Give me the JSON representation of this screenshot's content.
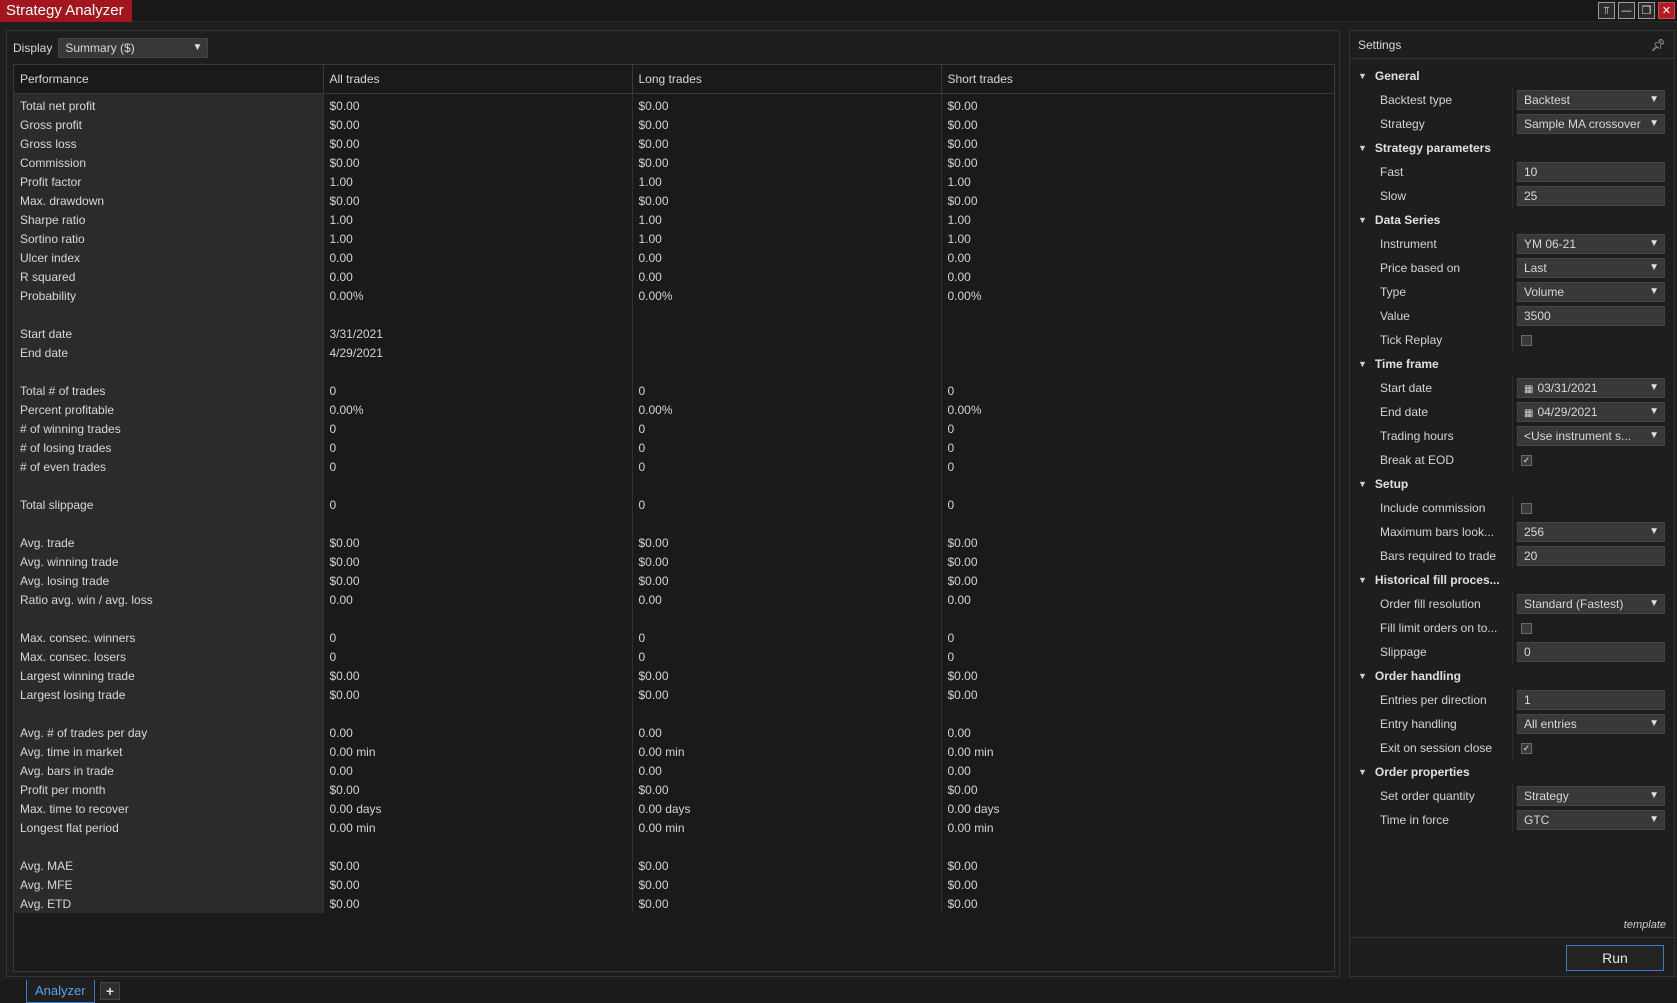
{
  "window": {
    "title": "Strategy Analyzer",
    "controls": [
      "⫪",
      "—",
      "❐",
      "✕"
    ]
  },
  "display": {
    "label": "Display",
    "value": "Summary ($)"
  },
  "table": {
    "headers": [
      "Performance",
      "All trades",
      "Long trades",
      "Short trades"
    ],
    "rows": [
      [
        "Total net profit",
        "$0.00",
        "$0.00",
        "$0.00"
      ],
      [
        "Gross profit",
        "$0.00",
        "$0.00",
        "$0.00"
      ],
      [
        "Gross loss",
        "$0.00",
        "$0.00",
        "$0.00"
      ],
      [
        "Commission",
        "$0.00",
        "$0.00",
        "$0.00"
      ],
      [
        "Profit factor",
        "1.00",
        "1.00",
        "1.00"
      ],
      [
        "Max. drawdown",
        "$0.00",
        "$0.00",
        "$0.00"
      ],
      [
        "Sharpe ratio",
        "1.00",
        "1.00",
        "1.00"
      ],
      [
        "Sortino ratio",
        "1.00",
        "1.00",
        "1.00"
      ],
      [
        "Ulcer index",
        "0.00",
        "0.00",
        "0.00"
      ],
      [
        "R squared",
        "0.00",
        "0.00",
        "0.00"
      ],
      [
        "Probability",
        "0.00%",
        "0.00%",
        "0.00%"
      ],
      [
        "",
        "",
        "",
        ""
      ],
      [
        "Start date",
        "3/31/2021",
        "",
        ""
      ],
      [
        "End date",
        "4/29/2021",
        "",
        ""
      ],
      [
        "",
        "",
        "",
        ""
      ],
      [
        "Total # of trades",
        "0",
        "0",
        "0"
      ],
      [
        "Percent profitable",
        "0.00%",
        "0.00%",
        "0.00%"
      ],
      [
        "# of winning trades",
        "0",
        "0",
        "0"
      ],
      [
        "# of losing trades",
        "0",
        "0",
        "0"
      ],
      [
        "# of even trades",
        "0",
        "0",
        "0"
      ],
      [
        "",
        "",
        "",
        ""
      ],
      [
        "Total slippage",
        "0",
        "0",
        "0"
      ],
      [
        "",
        "",
        "",
        ""
      ],
      [
        "Avg. trade",
        "$0.00",
        "$0.00",
        "$0.00"
      ],
      [
        "Avg. winning trade",
        "$0.00",
        "$0.00",
        "$0.00"
      ],
      [
        "Avg. losing trade",
        "$0.00",
        "$0.00",
        "$0.00"
      ],
      [
        "Ratio avg. win / avg. loss",
        "0.00",
        "0.00",
        "0.00"
      ],
      [
        "",
        "",
        "",
        ""
      ],
      [
        "Max. consec. winners",
        "0",
        "0",
        "0"
      ],
      [
        "Max. consec. losers",
        "0",
        "0",
        "0"
      ],
      [
        "Largest winning trade",
        "$0.00",
        "$0.00",
        "$0.00"
      ],
      [
        "Largest losing trade",
        "$0.00",
        "$0.00",
        "$0.00"
      ],
      [
        "",
        "",
        "",
        ""
      ],
      [
        "Avg. # of trades per day",
        "0.00",
        "0.00",
        "0.00"
      ],
      [
        "Avg. time in market",
        "0.00 min",
        "0.00 min",
        "0.00 min"
      ],
      [
        "Avg. bars in trade",
        "0.00",
        "0.00",
        "0.00"
      ],
      [
        "Profit per month",
        "$0.00",
        "$0.00",
        "$0.00"
      ],
      [
        "Max. time to recover",
        "0.00 days",
        "0.00 days",
        "0.00 days"
      ],
      [
        "Longest flat period",
        "0.00 min",
        "0.00 min",
        "0.00 min"
      ],
      [
        "",
        "",
        "",
        ""
      ],
      [
        "Avg. MAE",
        "$0.00",
        "$0.00",
        "$0.00"
      ],
      [
        "Avg. MFE",
        "$0.00",
        "$0.00",
        "$0.00"
      ],
      [
        "Avg. ETD",
        "$0.00",
        "$0.00",
        "$0.00"
      ]
    ]
  },
  "settings": {
    "title": "Settings",
    "template_label": "template",
    "run_label": "Run",
    "sections": [
      {
        "name": "General",
        "props": [
          {
            "name": "Backtest type",
            "kind": "dropdown",
            "value": "Backtest"
          },
          {
            "name": "Strategy",
            "kind": "dropdown",
            "value": "Sample MA crossover"
          }
        ]
      },
      {
        "name": "Strategy parameters",
        "props": [
          {
            "name": "Fast",
            "kind": "text",
            "value": "10"
          },
          {
            "name": "Slow",
            "kind": "text",
            "value": "25"
          }
        ]
      },
      {
        "name": "Data Series",
        "props": [
          {
            "name": "Instrument",
            "kind": "dropdown",
            "value": "YM 06-21"
          },
          {
            "name": "Price based on",
            "kind": "dropdown",
            "value": "Last"
          },
          {
            "name": "Type",
            "kind": "dropdown",
            "value": "Volume"
          },
          {
            "name": "Value",
            "kind": "text",
            "value": "3500"
          },
          {
            "name": "Tick Replay",
            "kind": "checkbox",
            "value": false
          }
        ]
      },
      {
        "name": "Time frame",
        "props": [
          {
            "name": "Start date",
            "kind": "date",
            "value": "03/31/2021"
          },
          {
            "name": "End date",
            "kind": "date",
            "value": "04/29/2021"
          },
          {
            "name": "Trading hours",
            "kind": "dropdown",
            "value": "<Use instrument s..."
          },
          {
            "name": "Break at EOD",
            "kind": "checkbox",
            "value": true
          }
        ]
      },
      {
        "name": "Setup",
        "props": [
          {
            "name": "Include commission",
            "kind": "checkbox",
            "value": false
          },
          {
            "name": "Maximum bars look...",
            "kind": "dropdown",
            "value": "256"
          },
          {
            "name": "Bars required to trade",
            "kind": "text",
            "value": "20"
          }
        ]
      },
      {
        "name": "Historical fill proces...",
        "props": [
          {
            "name": "Order fill resolution",
            "kind": "dropdown",
            "value": "Standard (Fastest)"
          },
          {
            "name": "Fill limit orders on to...",
            "kind": "checkbox",
            "value": false
          },
          {
            "name": "Slippage",
            "kind": "text",
            "value": "0"
          }
        ]
      },
      {
        "name": "Order handling",
        "props": [
          {
            "name": "Entries per direction",
            "kind": "text",
            "value": "1"
          },
          {
            "name": "Entry handling",
            "kind": "dropdown",
            "value": "All entries"
          },
          {
            "name": "Exit on session close",
            "kind": "checkbox",
            "value": true
          }
        ]
      },
      {
        "name": "Order properties",
        "props": [
          {
            "name": "Set order quantity",
            "kind": "dropdown",
            "value": "Strategy"
          },
          {
            "name": "Time in force",
            "kind": "dropdown",
            "value": "GTC"
          }
        ]
      }
    ]
  },
  "tabs": {
    "active": "Analyzer",
    "add_label": "+"
  }
}
